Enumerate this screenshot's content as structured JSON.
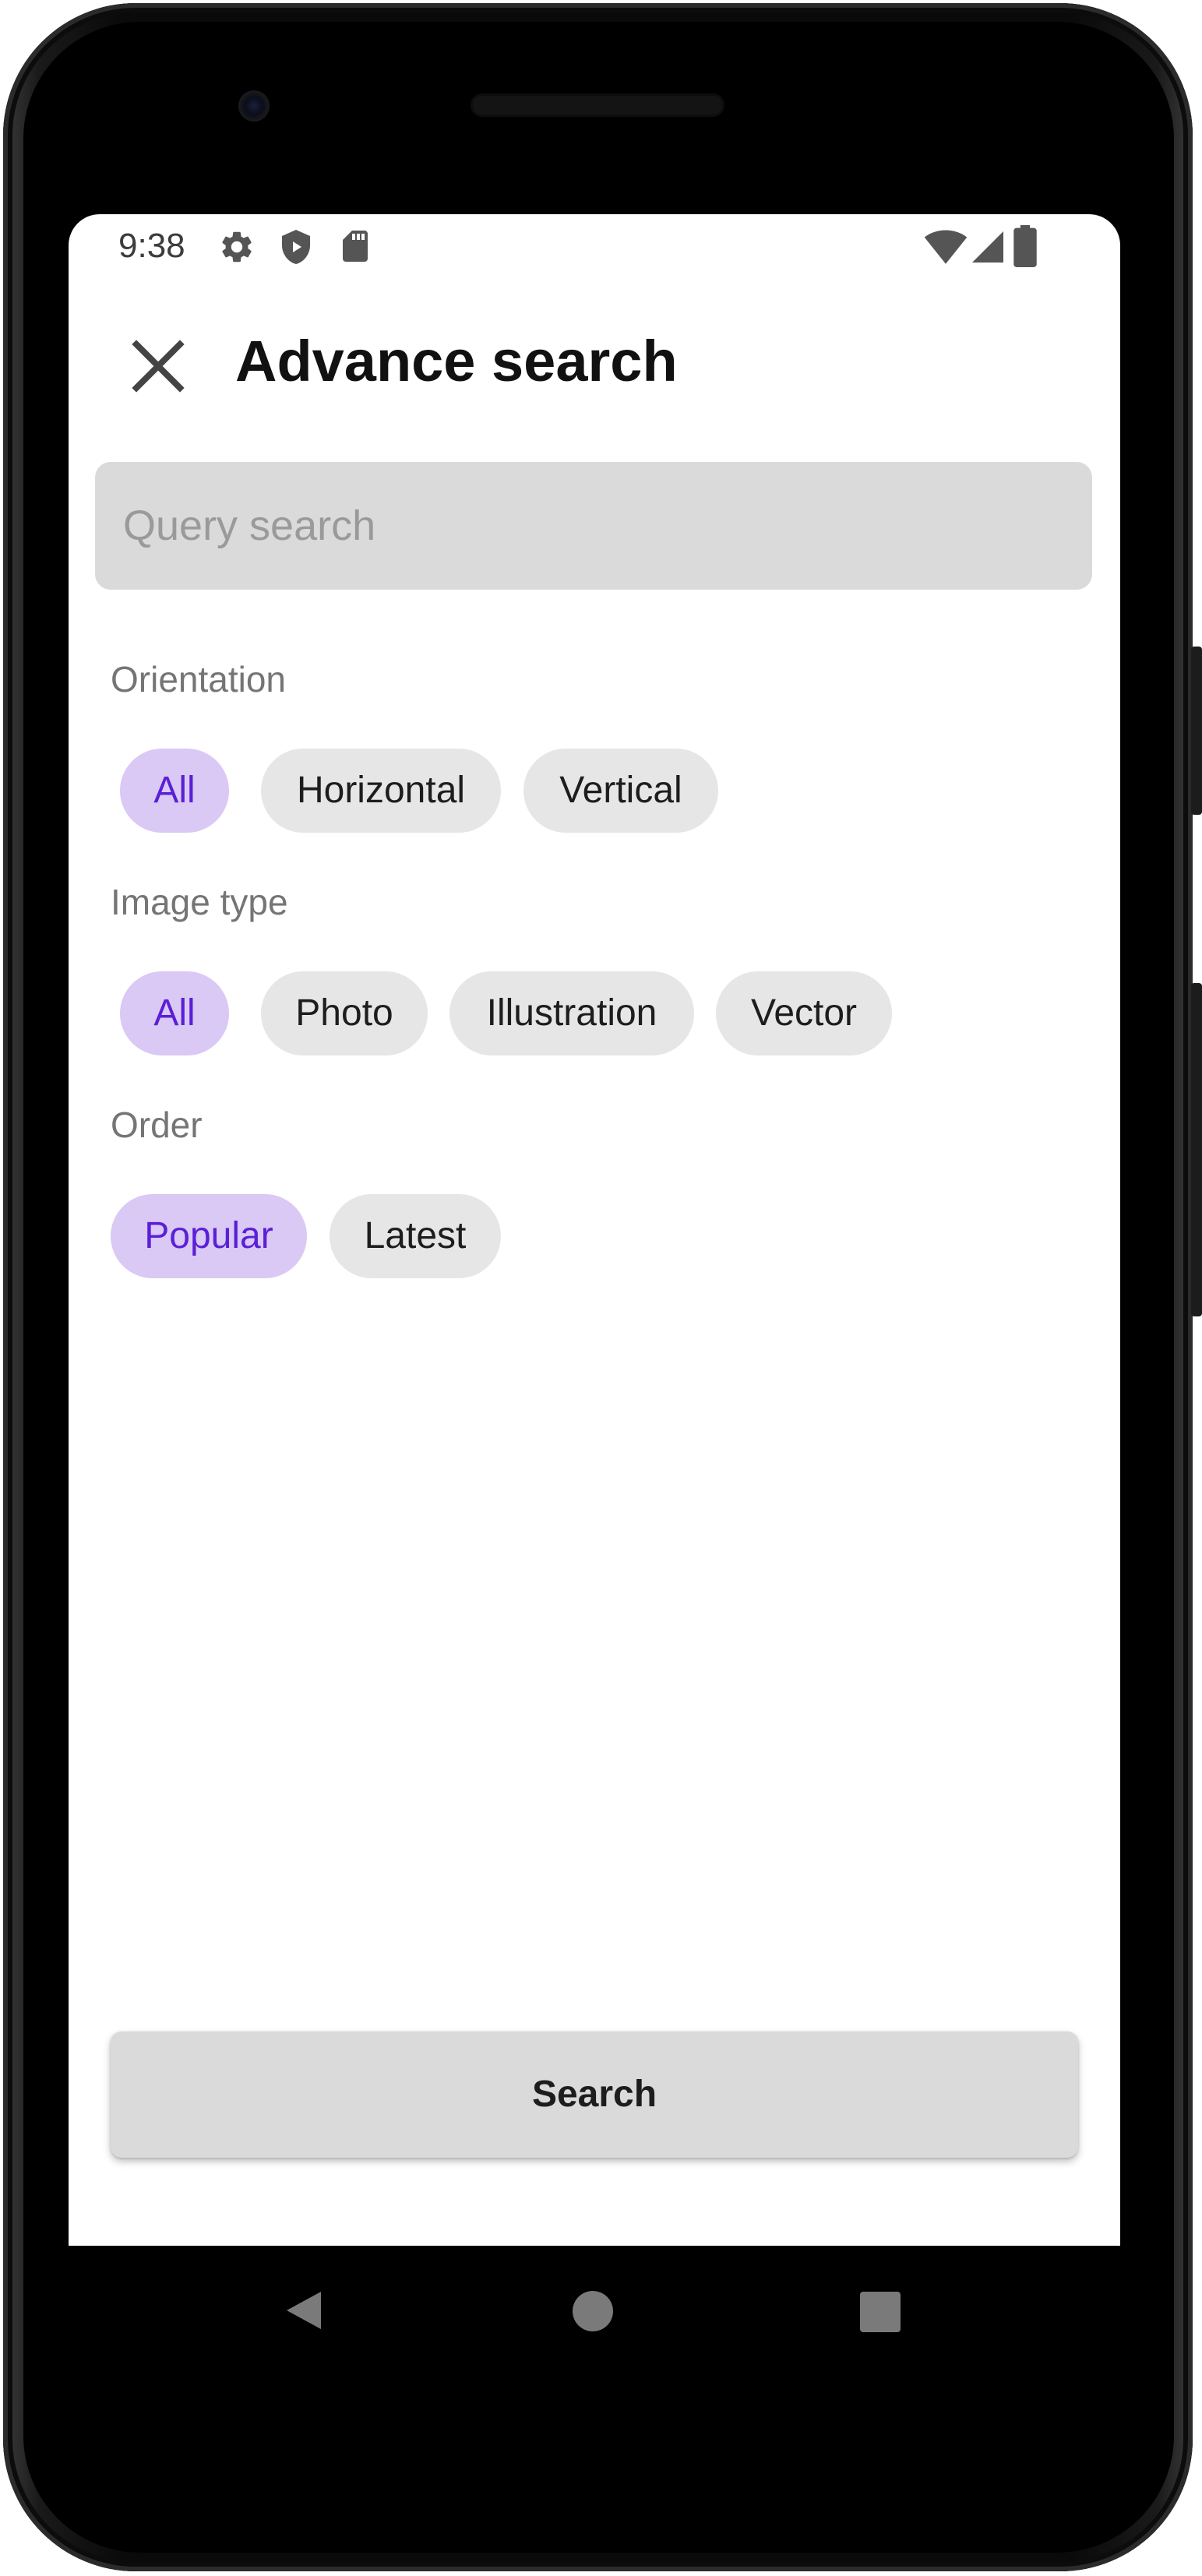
{
  "status_bar": {
    "time": "9:38",
    "left_icons": [
      "settings-icon",
      "shield-icon",
      "sd-card-icon"
    ],
    "right_icons": [
      "wifi-icon",
      "signal-icon",
      "battery-icon"
    ]
  },
  "header": {
    "close_icon": "close-icon",
    "title": "Advance search"
  },
  "search": {
    "placeholder": "Query search",
    "value": ""
  },
  "sections": {
    "orientation": {
      "label": "Orientation",
      "options": [
        "All",
        "Horizontal",
        "Vertical"
      ],
      "selected": "All"
    },
    "image_type": {
      "label": "Image type",
      "options": [
        "All",
        "Photo",
        "Illustration",
        "Vector"
      ],
      "selected": "All"
    },
    "order": {
      "label": "Order",
      "options": [
        "Popular",
        "Latest"
      ],
      "selected": "Popular"
    }
  },
  "actions": {
    "search_label": "Search"
  },
  "nav_bar": {
    "icons": [
      "back-icon",
      "home-icon",
      "recents-icon"
    ]
  },
  "colors": {
    "chip_selected_bg": "#dac8f5",
    "chip_selected_text": "#5a1fd6",
    "chip_bg": "#e6e6e6",
    "input_bg": "#dadada"
  }
}
